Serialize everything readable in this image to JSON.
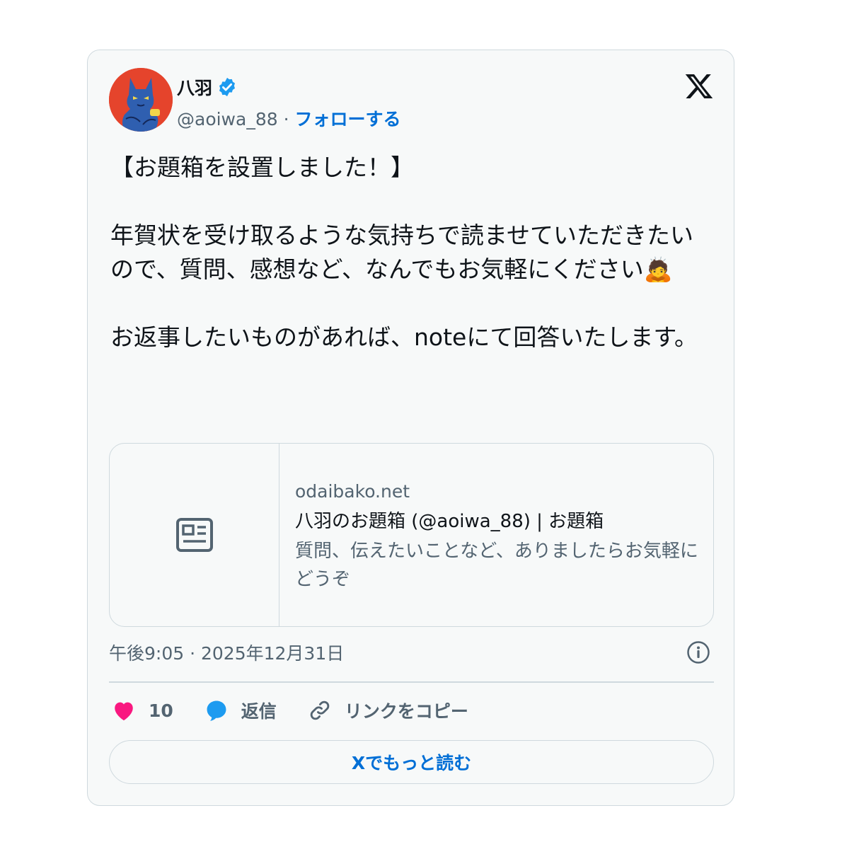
{
  "user": {
    "name": "八羽",
    "handle": "@aoiwa_88",
    "separator": " · ",
    "follow_label": "フォローする"
  },
  "tweet": {
    "text": "【お題箱を設置しました！】\n\n年賀状を受け取るような気持ちで読ませていただきたいので、質問、感想など、なんでもお気軽にください🙇\n\nお返事したいものがあれば、noteにて回答いたします。"
  },
  "link_card": {
    "domain": "odaibako.net",
    "title": "八羽のお題箱 (@aoiwa_88) | お題箱",
    "description": "質問、伝えたいことなど、ありましたらお気軽にどうぞ"
  },
  "timestamp": "午後9:05 · 2025年12月31日",
  "actions": {
    "like_count": "10",
    "reply_label": "返信",
    "copy_link_label": "リンクをコピー"
  },
  "read_more_label": "Xでもっと読む",
  "colors": {
    "accent": "#006fd6",
    "like": "#f91880",
    "reply": "#1d9bf0",
    "text": "#0f1419",
    "muted": "#536471",
    "border": "#cfd9de",
    "avatar_bg": "#e5442c"
  }
}
